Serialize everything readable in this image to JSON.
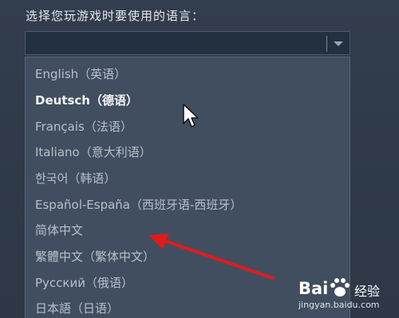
{
  "prompt": "选择您玩游戏时要使用的语言：",
  "select": {
    "value": ""
  },
  "languages": [
    "English（英语）",
    "Deutsch（德语）",
    "Français（法语）",
    "Italiano（意大利语）",
    "한국어（韩语）",
    "Español-España（西班牙语-西班牙）",
    "简体中文",
    "繁體中文（繁体中文）",
    "Русский（俄语）",
    "日本語（日语）"
  ],
  "highlighted_index": 1,
  "annotation": {
    "arrow_color": "#e01b1b"
  },
  "watermark": {
    "logo": "Bai",
    "logo_suffix": "经验",
    "url": "jingyan.baidu.com"
  }
}
